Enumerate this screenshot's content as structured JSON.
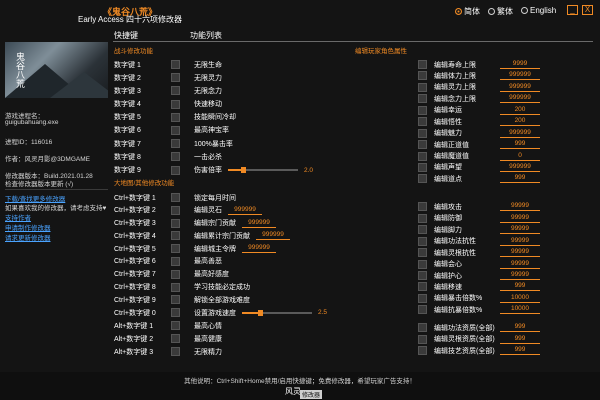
{
  "header": {
    "title": "《鬼谷八荒》",
    "subtitle": "Early Access 四十六项修改器",
    "languages": [
      {
        "label": "简体",
        "selected": true
      },
      {
        "label": "繁体",
        "selected": false
      },
      {
        "label": "English",
        "selected": false
      }
    ],
    "minimize": "_",
    "close": "X"
  },
  "sidebar": {
    "logo_text": "鬼谷八荒",
    "process_label": "游戏进程名：",
    "process_name": "guigubahuang.exe",
    "pid": "进程ID：116016",
    "author": "作者：风灵月影@3DMGAME",
    "build": "修改器版本：Build.2021.01.28",
    "update_check": "检查修改器版本更新 (√)",
    "links": [
      "下载/查找更多修改器",
      "如果喜欢我的修改器，请考虑支持♥",
      "支持作者",
      "申请制作修改器",
      "请求更新修改器"
    ]
  },
  "columns": {
    "hotkey": "快捷键",
    "function_list": "功能列表"
  },
  "sections": {
    "battle": "战斗修改功能",
    "map": "大地图/其他修改功能",
    "player": "编辑玩家角色属性"
  },
  "battle_rows": [
    {
      "key": "数字键 1",
      "desc": "无限生命"
    },
    {
      "key": "数字键 2",
      "desc": "无限灵力"
    },
    {
      "key": "数字键 3",
      "desc": "无限念力"
    },
    {
      "key": "数字键 4",
      "desc": "快速移动"
    },
    {
      "key": "数字键 5",
      "desc": "技能瞬间冷却"
    },
    {
      "key": "数字键 6",
      "desc": "最高神宝率"
    },
    {
      "key": "数字键 7",
      "desc": "100%暴击率"
    },
    {
      "key": "数字键 8",
      "desc": "一击必杀"
    },
    {
      "key": "数字键 9",
      "desc": "伤害倍率",
      "slider": "2.0",
      "slider_fraction": 0.22
    }
  ],
  "map_rows": [
    {
      "key": "Ctrl+数字键 1",
      "desc": "锁定每月时间"
    },
    {
      "key": "Ctrl+数字键 2",
      "desc": "编辑灵石",
      "value": "999999"
    },
    {
      "key": "Ctrl+数字键 3",
      "desc": "编辑宗门贡献",
      "value": "999999"
    },
    {
      "key": "Ctrl+数字键 4",
      "desc": "编辑累计宗门贡献",
      "value": "999999"
    },
    {
      "key": "Ctrl+数字键 5",
      "desc": "编辑城主令牌",
      "value": "999999"
    },
    {
      "key": "Ctrl+数字键 6",
      "desc": "最高善恶"
    },
    {
      "key": "Ctrl+数字键 7",
      "desc": "最高好感度"
    },
    {
      "key": "Ctrl+数字键 8",
      "desc": "学习技能必定成功"
    },
    {
      "key": "Ctrl+数字键 9",
      "desc": "解锁全部游戏难度"
    },
    {
      "key": "Ctrl+数字键 0",
      "desc": "设置游戏速度",
      "slider": "2.5",
      "slider_fraction": 0.25
    }
  ],
  "alt_rows": [
    {
      "key": "Alt+数字键 1",
      "desc": "最高心情"
    },
    {
      "key": "Alt+数字键 2",
      "desc": "最高健康"
    },
    {
      "key": "Alt+数字键 3",
      "desc": "无限精力"
    }
  ],
  "player_rows": [
    {
      "desc": "编辑寿命上限",
      "value": "9999"
    },
    {
      "desc": "编辑体力上限",
      "value": "999999"
    },
    {
      "desc": "编辑灵力上限",
      "value": "999999"
    },
    {
      "desc": "编辑念力上限",
      "value": "999999"
    },
    {
      "desc": "编辑幸运",
      "value": "200"
    },
    {
      "desc": "编辑悟性",
      "value": "200"
    },
    {
      "desc": "编辑魅力",
      "value": "999999"
    },
    {
      "desc": "编辑正道值",
      "value": "999"
    },
    {
      "desc": "编辑魔道值",
      "value": "0"
    },
    {
      "desc": "编辑声望",
      "value": "999999"
    },
    {
      "desc": "编辑道点",
      "value": "999"
    },
    {
      "desc": "编辑攻击",
      "value": "99999"
    },
    {
      "desc": "编辑防御",
      "value": "99999"
    },
    {
      "desc": "编辑脚力",
      "value": "99999"
    },
    {
      "desc": "编辑功法抗性",
      "value": "99999"
    },
    {
      "desc": "编辑灵根抗性",
      "value": "99999"
    },
    {
      "desc": "编辑会心",
      "value": "99999"
    },
    {
      "desc": "编辑护心",
      "value": "99999"
    },
    {
      "desc": "编辑移速",
      "value": "999"
    },
    {
      "desc": "编辑暴击倍数%",
      "value": "10000"
    },
    {
      "desc": "编辑抗暴倍数%",
      "value": "10000"
    },
    {
      "desc": "编辑功法资质(全部)",
      "value": "999"
    },
    {
      "desc": "编辑灵根资质(全部)",
      "value": "999"
    },
    {
      "desc": "编辑技艺资质(全部)",
      "value": "999"
    }
  ],
  "footer": {
    "text": "其他说明：Ctrl+Shift+Home禁用/启用快捷键；免费修改器，希望玩家广告支持！",
    "logo": "风灵",
    "badge": "修改器"
  }
}
